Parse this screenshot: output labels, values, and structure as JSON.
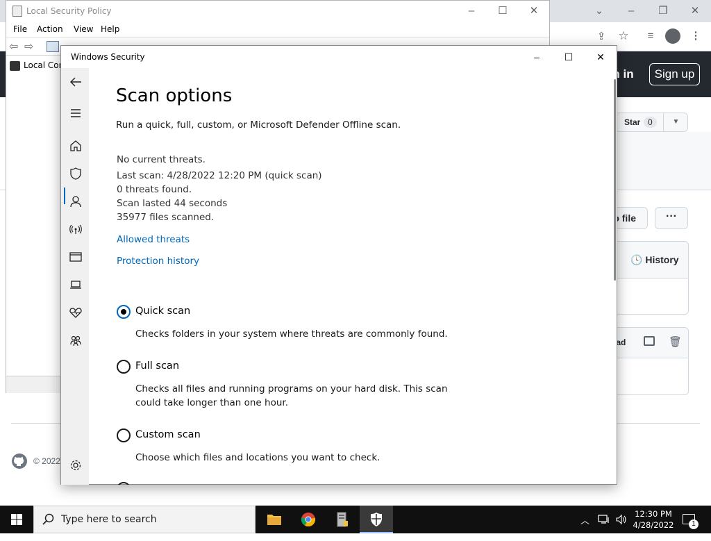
{
  "browser": {
    "github": {
      "sign_in": "Sign in",
      "sign_in_visible": "gn in",
      "sign_up": "Sign up",
      "star_label": "Star",
      "star_count": "0",
      "file_button": "o file",
      "more_button": "···",
      "history": "History",
      "download_partial": "oad",
      "copyright": "© 2022"
    }
  },
  "local_security_policy": {
    "title": "Local Security Policy",
    "menu": [
      "File",
      "Action",
      "View",
      "Help"
    ],
    "tree_item": "Local Com"
  },
  "windows_security": {
    "title": "Windows Security",
    "page_title": "Scan options",
    "subtitle": "Run a quick, full, custom, or Microsoft Defender Offline scan.",
    "status": {
      "no_threats": "No current threats.",
      "last_scan": "Last scan: 4/28/2022 12:20 PM (quick scan)",
      "threats_found": "0 threats found.",
      "duration": "Scan lasted 44 seconds",
      "files_scanned": "35977 files scanned."
    },
    "links": {
      "allowed_threats": "Allowed threats",
      "protection_history": "Protection history"
    },
    "scan_options": [
      {
        "label": "Quick scan",
        "description": "Checks folders in your system where threats are commonly found.",
        "selected": true
      },
      {
        "label": "Full scan",
        "description": "Checks all files and running programs on your hard disk. This scan could take longer than one hour.",
        "selected": false
      },
      {
        "label": "Custom scan",
        "description": "Choose which files and locations you want to check.",
        "selected": false
      }
    ]
  },
  "taskbar": {
    "search_placeholder": "Type here to search",
    "time": "12:30 PM",
    "date": "4/28/2022",
    "notification_count": "1"
  },
  "colors": {
    "accent": "#0067c0",
    "link": "#0067b8",
    "github_header": "#24292f",
    "taskbar": "#101010"
  }
}
